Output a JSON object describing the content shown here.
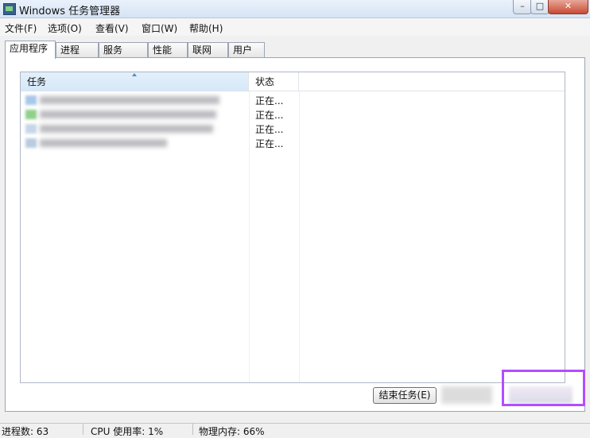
{
  "window": {
    "title": "Windows 任务管理器",
    "minimize_glyph": "–",
    "maximize_glyph": "□",
    "close_glyph": "✕"
  },
  "menu": [
    "文件(F)",
    "选项(O)",
    "查看(V)",
    "窗口(W)",
    "帮助(H)"
  ],
  "tabs": [
    "应用程序",
    "进程",
    "服务",
    "性能",
    "联网",
    "用户"
  ],
  "active_tab": "应用程序",
  "task_list": {
    "columns": [
      "任务",
      "状态"
    ],
    "rows": [
      {
        "status": "正在..."
      },
      {
        "status": "正在..."
      },
      {
        "status": "正在..."
      },
      {
        "status": "正在..."
      }
    ]
  },
  "buttons": {
    "end_task": "结束任务(E)"
  },
  "highlight_color": "#b24dff",
  "status_bar": {
    "processes": "进程数: 63",
    "cpu": "CPU 使用率: 1%",
    "memory": "物理内存: 66%"
  }
}
